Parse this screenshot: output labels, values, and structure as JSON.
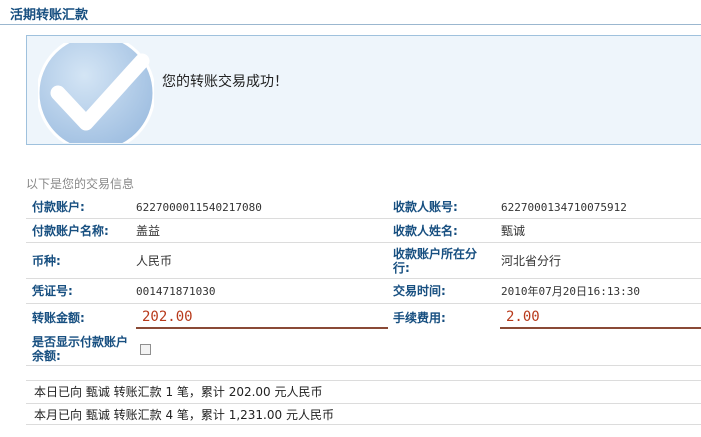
{
  "page": {
    "title": "活期转账汇款"
  },
  "result": {
    "message": "您的转账交易成功！"
  },
  "details": {
    "section_title": "以下是您的交易信息",
    "payer_account_label": "付款账户:",
    "payer_account_value": "6227000011540217080",
    "payee_account_label": "收款人账号:",
    "payee_account_value": "6227000134710075912",
    "payer_name_label": "付款账户名称:",
    "payer_name_value": "盖益",
    "payee_name_label": "收款人姓名:",
    "payee_name_value": "甄诚",
    "currency_label": "币种:",
    "currency_value": "人民币",
    "payee_branch_label": "收款账户所在分行:",
    "payee_branch_value": "河北省分行",
    "voucher_label": "凭证号:",
    "voucher_value": "001471871030",
    "time_label": "交易时间:",
    "time_value": "2010年07月20日16:13:30",
    "amount_label": "转账金额:",
    "amount_value": "202.00",
    "fee_label": "手续费用:",
    "fee_value": "2.00",
    "show_balance_label": "是否显示付款账户余额:",
    "show_balance_checked": false
  },
  "summary": {
    "today": "本日已向 甄诚 转账汇款 1 笔，累计 202.00 元人民币",
    "month": "本月已向 甄诚 转账汇款 4 笔，累计 1,231.00 元人民币"
  },
  "colors": {
    "label": "#174f80",
    "amount": "#b83a1b",
    "success_bg": "#eef5fb",
    "check_circle": "#a9c6e3"
  }
}
